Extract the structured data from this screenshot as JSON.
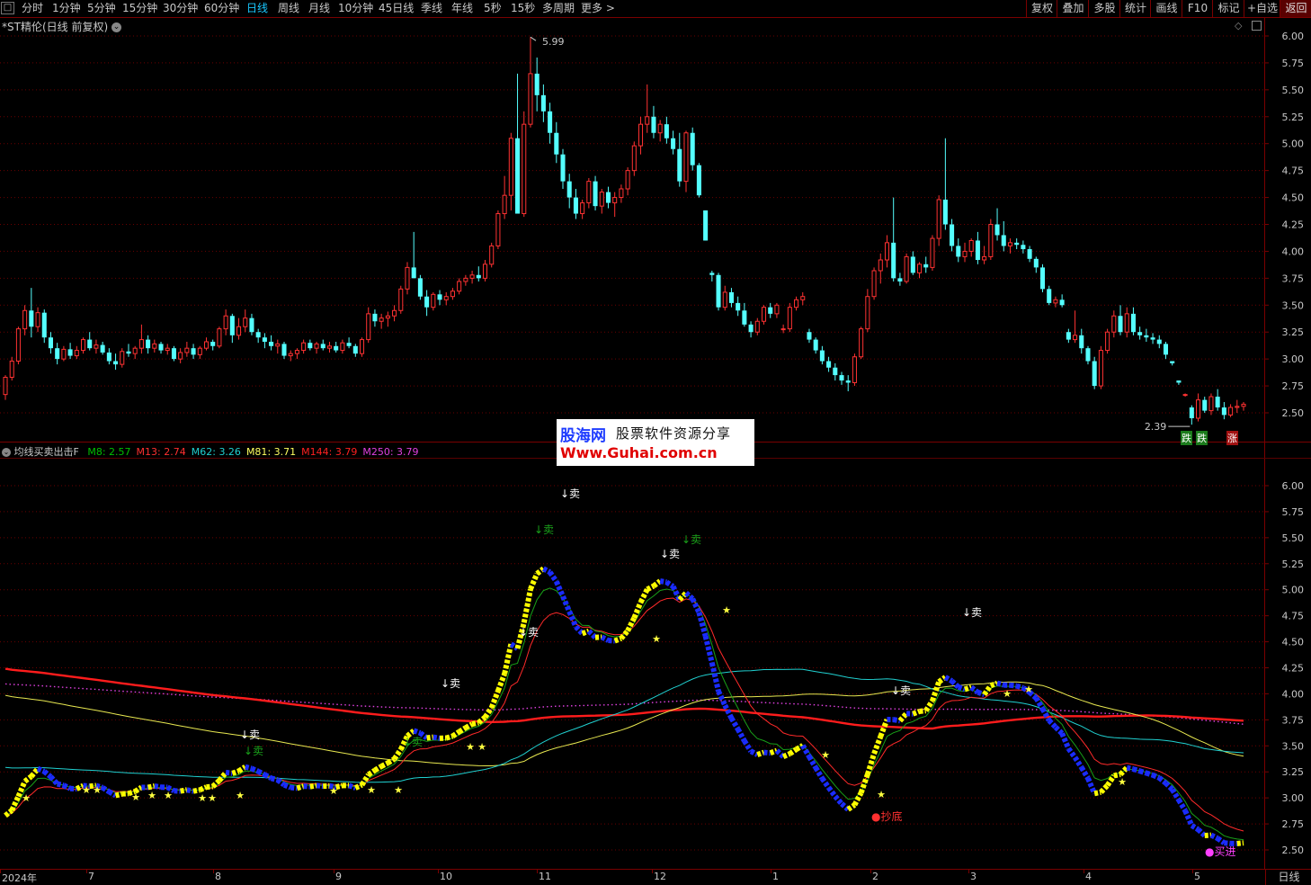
{
  "toolbar": {
    "periods": [
      "分时",
      "1分钟",
      "5分钟",
      "15分钟",
      "30分钟",
      "60分钟",
      "日线",
      "周线",
      "月线",
      "10分钟",
      "45日线",
      "季线",
      "年线",
      "5秒",
      "15秒",
      "多周期",
      "更多 >"
    ],
    "active_period": "日线",
    "buttons": [
      "复权",
      "叠加",
      "多股",
      "统计",
      "画线",
      "F10",
      "标记",
      "+自选",
      "返回"
    ]
  },
  "price_panel": {
    "title": "*ST精伦(日线 前复权)",
    "y_ticks": [
      "6.00",
      "5.75",
      "5.50",
      "5.25",
      "5.00",
      "4.75",
      "4.50",
      "4.25",
      "4.00",
      "3.75",
      "3.50",
      "3.25",
      "3.00",
      "2.75",
      "2.50"
    ],
    "high_label": "5.99",
    "low_label": "2.39",
    "badge_left": "跌",
    "badge_left2": "跌",
    "badge_right": "涨"
  },
  "indicator_panel": {
    "title": "均线买卖出击F",
    "ma": [
      {
        "name": "M8",
        "value": "2.57",
        "color": "#00c000"
      },
      {
        "name": "M13",
        "value": "2.74",
        "color": "#ff3030"
      },
      {
        "name": "M62",
        "value": "3.26",
        "color": "#20d0d0"
      },
      {
        "name": "M81",
        "value": "3.71",
        "color": "#ffff60"
      },
      {
        "name": "M144",
        "value": "3.79",
        "color": "#ff2020"
      },
      {
        "name": "M250",
        "value": "3.79",
        "color": "#e040e0"
      }
    ],
    "y_ticks": [
      "6.00",
      "5.75",
      "5.50",
      "5.25",
      "5.00",
      "4.75",
      "4.50",
      "4.25",
      "4.00",
      "3.75",
      "3.50",
      "3.25",
      "3.00",
      "2.75",
      "2.50"
    ],
    "sell_label": "↓卖",
    "star_label": "★",
    "bottom_label": "●抄底",
    "buy_label": "●买进"
  },
  "x_axis": {
    "labels": [
      "2024年",
      "7",
      "8",
      "9",
      "10",
      "11",
      "12",
      "1",
      "2",
      "3",
      "4",
      "5"
    ]
  },
  "period_box": "日线",
  "watermark": {
    "line1a": "股海网",
    "line1b": "股票软件资源分享",
    "line2": "Www.Guhai.com.cn"
  },
  "chart_data": {
    "type": "candlestick",
    "title": "*ST精伦(日线 前复权)",
    "ylim": [
      2.39,
      6.05
    ],
    "x_months": [
      "2024年",
      "7",
      "8",
      "9",
      "10",
      "11",
      "12",
      "1",
      "2",
      "3",
      "4",
      "5"
    ],
    "ohlc": [
      [
        2.67,
        2.85,
        2.62,
        2.83
      ],
      [
        2.83,
        3.02,
        2.8,
        2.98
      ],
      [
        2.98,
        3.3,
        2.95,
        3.28
      ],
      [
        3.28,
        3.5,
        3.22,
        3.45
      ],
      [
        3.45,
        3.66,
        3.2,
        3.3
      ],
      [
        3.3,
        3.48,
        3.25,
        3.43
      ],
      [
        3.43,
        3.46,
        3.15,
        3.2
      ],
      [
        3.2,
        3.25,
        3.05,
        3.1
      ],
      [
        3.1,
        3.15,
        2.95,
        3.0
      ],
      [
        3.0,
        3.12,
        2.98,
        3.09
      ],
      [
        3.09,
        3.15,
        3.0,
        3.03
      ],
      [
        3.03,
        3.12,
        3.0,
        3.08
      ],
      [
        3.08,
        3.2,
        3.05,
        3.18
      ],
      [
        3.18,
        3.25,
        3.08,
        3.1
      ],
      [
        3.1,
        3.18,
        3.05,
        3.13
      ],
      [
        3.13,
        3.16,
        3.04,
        3.06
      ],
      [
        3.06,
        3.1,
        2.95,
        2.98
      ],
      [
        2.98,
        3.05,
        2.9,
        2.95
      ],
      [
        2.95,
        3.1,
        2.92,
        3.07
      ],
      [
        3.07,
        3.14,
        3.02,
        3.05
      ],
      [
        3.05,
        3.12,
        3.0,
        3.1
      ],
      [
        3.1,
        3.32,
        3.05,
        3.18
      ],
      [
        3.18,
        3.22,
        3.05,
        3.1
      ],
      [
        3.1,
        3.18,
        3.06,
        3.14
      ],
      [
        3.14,
        3.16,
        3.05,
        3.08
      ],
      [
        3.08,
        3.14,
        3.04,
        3.1
      ],
      [
        3.1,
        3.12,
        2.98,
        3.0
      ],
      [
        3.0,
        3.1,
        2.96,
        3.06
      ],
      [
        3.06,
        3.16,
        3.02,
        3.1
      ],
      [
        3.1,
        3.14,
        3.0,
        3.04
      ],
      [
        3.04,
        3.12,
        3.0,
        3.1
      ],
      [
        3.1,
        3.2,
        3.08,
        3.16
      ],
      [
        3.16,
        3.18,
        3.08,
        3.12
      ],
      [
        3.12,
        3.3,
        3.1,
        3.28
      ],
      [
        3.28,
        3.46,
        3.22,
        3.4
      ],
      [
        3.4,
        3.42,
        3.15,
        3.22
      ],
      [
        3.22,
        3.38,
        3.18,
        3.3
      ],
      [
        3.3,
        3.46,
        3.25,
        3.38
      ],
      [
        3.38,
        3.42,
        3.22,
        3.25
      ],
      [
        3.25,
        3.28,
        3.15,
        3.2
      ],
      [
        3.2,
        3.24,
        3.1,
        3.16
      ],
      [
        3.16,
        3.22,
        3.08,
        3.12
      ],
      [
        3.12,
        3.18,
        3.05,
        3.14
      ],
      [
        3.14,
        3.16,
        3.0,
        3.03
      ],
      [
        3.03,
        3.08,
        2.98,
        3.05
      ],
      [
        3.05,
        3.1,
        3.0,
        3.08
      ],
      [
        3.08,
        3.18,
        3.05,
        3.15
      ],
      [
        3.15,
        3.18,
        3.08,
        3.1
      ],
      [
        3.1,
        3.16,
        3.05,
        3.14
      ],
      [
        3.14,
        3.18,
        3.08,
        3.1
      ],
      [
        3.1,
        3.16,
        3.06,
        3.12
      ],
      [
        3.12,
        3.16,
        3.06,
        3.08
      ],
      [
        3.08,
        3.18,
        3.05,
        3.15
      ],
      [
        3.15,
        3.2,
        3.1,
        3.12
      ],
      [
        3.12,
        3.14,
        3.02,
        3.05
      ],
      [
        3.05,
        3.2,
        3.02,
        3.18
      ],
      [
        3.18,
        3.48,
        3.15,
        3.42
      ],
      [
        3.42,
        3.46,
        3.3,
        3.35
      ],
      [
        3.35,
        3.42,
        3.28,
        3.38
      ],
      [
        3.38,
        3.44,
        3.3,
        3.4
      ],
      [
        3.4,
        3.5,
        3.35,
        3.45
      ],
      [
        3.45,
        3.68,
        3.42,
        3.65
      ],
      [
        3.65,
        3.9,
        3.6,
        3.85
      ],
      [
        3.85,
        4.18,
        3.8,
        3.75
      ],
      [
        3.75,
        3.78,
        3.55,
        3.58
      ],
      [
        3.58,
        3.64,
        3.4,
        3.48
      ],
      [
        3.48,
        3.62,
        3.45,
        3.6
      ],
      [
        3.6,
        3.64,
        3.5,
        3.55
      ],
      [
        3.55,
        3.62,
        3.5,
        3.58
      ],
      [
        3.58,
        3.66,
        3.55,
        3.63
      ],
      [
        3.63,
        3.75,
        3.6,
        3.72
      ],
      [
        3.72,
        3.78,
        3.68,
        3.75
      ],
      [
        3.75,
        3.82,
        3.7,
        3.78
      ],
      [
        3.78,
        3.86,
        3.72,
        3.75
      ],
      [
        3.75,
        3.92,
        3.72,
        3.88
      ],
      [
        3.88,
        4.08,
        3.85,
        4.05
      ],
      [
        4.05,
        4.38,
        4.02,
        4.35
      ],
      [
        4.35,
        4.7,
        4.3,
        4.52
      ],
      [
        4.52,
        5.1,
        4.38,
        5.05
      ],
      [
        5.05,
        5.65,
        4.4,
        4.35
      ],
      [
        4.35,
        5.3,
        4.32,
        5.18
      ],
      [
        5.18,
        5.99,
        5.15,
        5.65
      ],
      [
        5.65,
        5.8,
        5.3,
        5.45
      ],
      [
        5.45,
        5.55,
        5.2,
        5.3
      ],
      [
        5.3,
        5.38,
        5.0,
        5.1
      ],
      [
        5.1,
        5.2,
        4.82,
        4.9
      ],
      [
        4.9,
        4.95,
        4.58,
        4.65
      ],
      [
        4.65,
        4.72,
        4.4,
        4.5
      ],
      [
        4.5,
        4.58,
        4.3,
        4.35
      ],
      [
        4.35,
        4.48,
        4.3,
        4.45
      ],
      [
        4.45,
        4.68,
        4.4,
        4.65
      ],
      [
        4.65,
        4.7,
        4.38,
        4.42
      ],
      [
        4.42,
        4.58,
        4.35,
        4.55
      ],
      [
        4.55,
        4.6,
        4.4,
        4.45
      ],
      [
        4.45,
        4.55,
        4.32,
        4.5
      ],
      [
        4.5,
        4.62,
        4.45,
        4.58
      ],
      [
        4.58,
        4.78,
        4.52,
        4.75
      ],
      [
        4.75,
        5.02,
        4.7,
        4.98
      ],
      [
        4.98,
        5.25,
        4.9,
        5.18
      ],
      [
        5.18,
        5.55,
        5.1,
        5.25
      ],
      [
        5.25,
        5.35,
        5.05,
        5.1
      ],
      [
        5.1,
        5.22,
        5.02,
        5.18
      ],
      [
        5.18,
        5.25,
        5.0,
        5.05
      ],
      [
        5.05,
        5.12,
        4.9,
        4.95
      ],
      [
        4.95,
        5.1,
        4.6,
        4.65
      ],
      [
        4.65,
        5.12,
        4.55,
        5.1
      ],
      [
        5.1,
        5.15,
        4.75,
        4.8
      ],
      [
        4.8,
        4.82,
        4.5,
        4.52
      ],
      [
        4.38,
        4.38,
        4.1,
        4.1
      ],
      [
        3.8,
        3.82,
        3.72,
        3.78
      ],
      [
        3.78,
        3.8,
        3.45,
        3.48
      ],
      [
        3.48,
        3.68,
        3.45,
        3.62
      ],
      [
        3.62,
        3.66,
        3.48,
        3.52
      ],
      [
        3.52,
        3.58,
        3.4,
        3.45
      ],
      [
        3.45,
        3.52,
        3.3,
        3.32
      ],
      [
        3.32,
        3.35,
        3.2,
        3.25
      ],
      [
        3.25,
        3.38,
        3.22,
        3.35
      ],
      [
        3.35,
        3.5,
        3.32,
        3.48
      ],
      [
        3.48,
        3.52,
        3.38,
        3.42
      ],
      [
        3.42,
        3.52,
        3.38,
        3.5
      ],
      [
        3.28,
        3.32,
        3.24,
        3.28
      ],
      [
        3.28,
        3.52,
        3.25,
        3.48
      ],
      [
        3.48,
        3.58,
        3.45,
        3.55
      ],
      [
        3.55,
        3.62,
        3.5,
        3.58
      ],
      [
        3.25,
        3.28,
        3.15,
        3.18
      ],
      [
        3.18,
        3.2,
        3.05,
        3.08
      ],
      [
        3.08,
        3.12,
        2.95,
        2.98
      ],
      [
        2.98,
        3.02,
        2.88,
        2.92
      ],
      [
        2.92,
        2.96,
        2.8,
        2.85
      ],
      [
        2.85,
        2.88,
        2.76,
        2.8
      ],
      [
        2.8,
        2.85,
        2.7,
        2.78
      ],
      [
        2.78,
        3.05,
        2.75,
        3.02
      ],
      [
        3.02,
        3.3,
        3.0,
        3.28
      ],
      [
        3.28,
        3.65,
        3.25,
        3.58
      ],
      [
        3.58,
        3.85,
        3.55,
        3.82
      ],
      [
        3.82,
        3.98,
        3.7,
        3.92
      ],
      [
        3.92,
        4.15,
        3.85,
        4.08
      ],
      [
        4.08,
        4.5,
        3.72,
        3.75
      ],
      [
        3.75,
        3.8,
        3.68,
        3.72
      ],
      [
        3.72,
        3.98,
        3.7,
        3.95
      ],
      [
        3.95,
        4.0,
        3.78,
        3.8
      ],
      [
        3.8,
        3.9,
        3.75,
        3.88
      ],
      [
        3.88,
        3.95,
        3.8,
        3.85
      ],
      [
        3.85,
        4.15,
        3.82,
        4.12
      ],
      [
        4.12,
        4.52,
        4.05,
        4.48
      ],
      [
        4.48,
        5.05,
        4.2,
        4.25
      ],
      [
        4.25,
        4.3,
        4.0,
        4.05
      ],
      [
        4.05,
        4.12,
        3.9,
        3.95
      ],
      [
        3.95,
        4.08,
        3.9,
        4.0
      ],
      [
        4.0,
        4.12,
        3.95,
        4.1
      ],
      [
        4.1,
        4.18,
        3.88,
        3.92
      ],
      [
        3.92,
        4.05,
        3.88,
        3.95
      ],
      [
        3.95,
        4.3,
        3.92,
        4.25
      ],
      [
        4.25,
        4.4,
        4.1,
        4.15
      ],
      [
        4.15,
        4.28,
        4.0,
        4.05
      ],
      [
        4.05,
        4.12,
        3.98,
        4.08
      ],
      [
        4.08,
        4.12,
        4.02,
        4.06
      ],
      [
        4.06,
        4.1,
        3.98,
        4.02
      ],
      [
        4.02,
        4.05,
        3.9,
        3.93
      ],
      [
        3.93,
        3.95,
        3.8,
        3.85
      ],
      [
        3.85,
        3.88,
        3.62,
        3.65
      ],
      [
        3.65,
        3.68,
        3.5,
        3.52
      ],
      [
        3.52,
        3.58,
        3.48,
        3.55
      ],
      [
        3.55,
        3.6,
        3.48,
        3.5
      ],
      [
        3.25,
        3.28,
        3.15,
        3.18
      ],
      [
        3.18,
        3.45,
        3.15,
        3.22
      ],
      [
        3.22,
        3.28,
        3.05,
        3.1
      ],
      [
        3.1,
        3.12,
        2.95,
        2.98
      ],
      [
        2.98,
        3.02,
        2.72,
        2.75
      ],
      [
        2.75,
        3.12,
        2.72,
        3.08
      ],
      [
        3.08,
        3.28,
        3.05,
        3.25
      ],
      [
        3.25,
        3.45,
        3.2,
        3.4
      ],
      [
        3.4,
        3.5,
        3.22,
        3.25
      ],
      [
        3.25,
        3.48,
        3.2,
        3.42
      ],
      [
        3.42,
        3.48,
        3.22,
        3.25
      ],
      [
        3.25,
        3.3,
        3.18,
        3.22
      ],
      [
        3.22,
        3.28,
        3.16,
        3.2
      ],
      [
        3.2,
        3.24,
        3.14,
        3.18
      ],
      [
        3.18,
        3.22,
        3.1,
        3.14
      ],
      [
        3.14,
        3.16,
        3.0,
        3.04
      ],
      [
        2.98,
        2.98,
        2.94,
        2.96
      ],
      [
        2.8,
        2.8,
        2.76,
        2.78
      ],
      [
        2.67,
        2.68,
        2.65,
        2.67
      ],
      [
        2.55,
        2.57,
        2.39,
        2.45
      ],
      [
        2.45,
        2.68,
        2.42,
        2.62
      ],
      [
        2.62,
        2.65,
        2.5,
        2.52
      ],
      [
        2.52,
        2.68,
        2.48,
        2.65
      ],
      [
        2.65,
        2.72,
        2.52,
        2.55
      ],
      [
        2.55,
        2.6,
        2.44,
        2.48
      ],
      [
        2.48,
        2.58,
        2.46,
        2.55
      ],
      [
        2.55,
        2.62,
        2.5,
        2.56
      ],
      [
        2.56,
        2.6,
        2.52,
        2.58
      ]
    ],
    "indicator_series": [
      {
        "name": "M8",
        "last": 2.57
      },
      {
        "name": "M13",
        "last": 2.74
      },
      {
        "name": "M62",
        "last": 3.26
      },
      {
        "name": "M81",
        "last": 3.71
      },
      {
        "name": "M144",
        "last": 3.79
      },
      {
        "name": "M250",
        "last": 3.79
      }
    ]
  }
}
